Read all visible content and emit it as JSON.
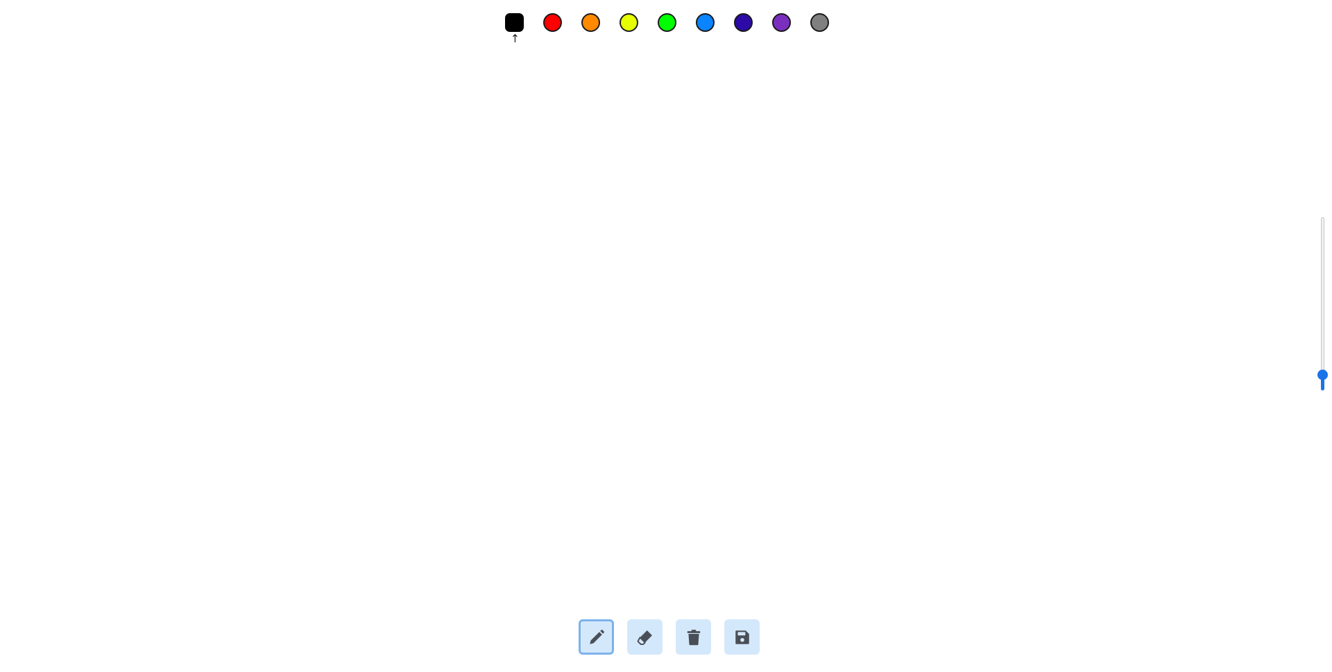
{
  "palette": {
    "colors": [
      {
        "name": "black",
        "hex": "#000000"
      },
      {
        "name": "red",
        "hex": "#ff0000"
      },
      {
        "name": "orange",
        "hex": "#ff8a00"
      },
      {
        "name": "yellow",
        "hex": "#e6ff00"
      },
      {
        "name": "green",
        "hex": "#00ff00"
      },
      {
        "name": "blue",
        "hex": "#0a84ff"
      },
      {
        "name": "indigo",
        "hex": "#2b0aa6"
      },
      {
        "name": "purple",
        "hex": "#7b2fbf"
      },
      {
        "name": "gray",
        "hex": "#808080"
      }
    ],
    "selected_index": 0,
    "selected_marker": "↑"
  },
  "brush_size": {
    "value_fraction": 0.06,
    "accent": "#1a73e8"
  },
  "toolbar": {
    "tools": [
      {
        "name": "pencil",
        "icon": "pencil-icon",
        "active": true
      },
      {
        "name": "eraser",
        "icon": "eraser-icon",
        "active": false
      },
      {
        "name": "clear",
        "icon": "trash-icon",
        "active": false
      },
      {
        "name": "save",
        "icon": "floppy-disk-icon",
        "active": false
      }
    ],
    "icon_color": "#4a4f57",
    "button_bg": "#d4e8fb",
    "active_border": "#7cb3ec"
  }
}
